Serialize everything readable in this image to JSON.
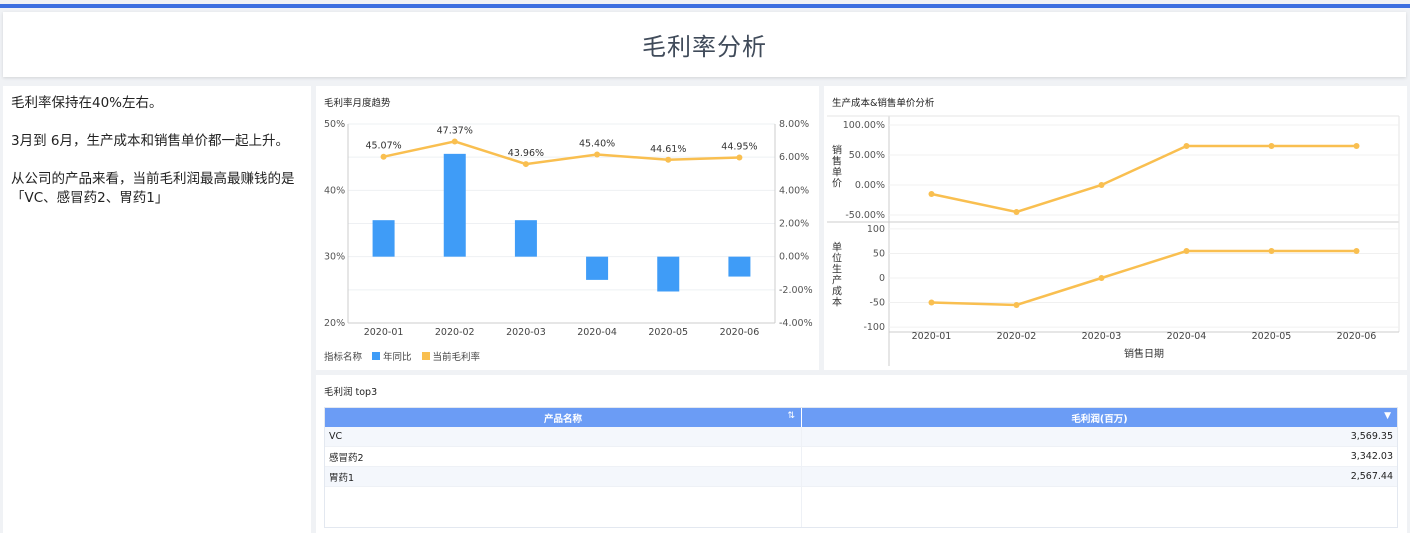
{
  "header": {
    "title": "毛利率分析"
  },
  "summary": {
    "p1": "毛利率保持在40%左右。",
    "p2": "3月到 6月，生产成本和销售单价都一起上升。",
    "p3": "从公司的产品来看，当前毛利润最高最赚钱的是「VC、感冒药2、胃药1」"
  },
  "chart_data": [
    {
      "type": "bar",
      "title": "毛利率月度趋势",
      "categories": [
        "2020-01",
        "2020-02",
        "2020-03",
        "2020-04",
        "2020-05",
        "2020-06"
      ],
      "series": [
        {
          "name": "年同比",
          "type": "bar",
          "axis": "right",
          "values": [
            2.2,
            6.2,
            2.2,
            -1.4,
            -2.1,
            -1.2
          ],
          "color": "#3f9cf7"
        },
        {
          "name": "当前毛利率",
          "type": "line",
          "axis": "left",
          "values": [
            45.07,
            47.37,
            43.96,
            45.4,
            44.61,
            44.95
          ],
          "labels": [
            "45.07%",
            "47.37%",
            "43.96%",
            "45.40%",
            "44.61%",
            "44.95%"
          ],
          "color": "#f9bf50"
        }
      ],
      "y_left": {
        "ticks": [
          "50%",
          "40%",
          "30%",
          "20%"
        ],
        "range": [
          20,
          50
        ]
      },
      "y_right": {
        "ticks": [
          "8.00%",
          "6.00%",
          "4.00%",
          "2.00%",
          "0.00%",
          "-2.00%",
          "-4.00%"
        ],
        "range": [
          -4,
          8
        ]
      },
      "legend": {
        "label": "指标名称",
        "items": [
          "年同比",
          "当前毛利率"
        ],
        "position": "bottom-left"
      }
    },
    {
      "type": "line",
      "title": "生产成本&销售单价分析",
      "categories": [
        "2020-01",
        "2020-02",
        "2020-03",
        "2020-04",
        "2020-05",
        "2020-06"
      ],
      "xlabel": "销售日期",
      "panels": [
        {
          "ylabel": "销售单价",
          "values": [
            -15,
            -45,
            0,
            65,
            65,
            65
          ],
          "ticks": [
            "100.00%",
            "50.00%",
            "0.00%",
            "-50.00%"
          ],
          "range": [
            -60,
            110
          ],
          "color": "#f9bf50"
        },
        {
          "ylabel": "单位生产成本",
          "values": [
            -50,
            -55,
            0,
            55,
            55,
            55
          ],
          "ticks": [
            "100",
            "50",
            "0",
            "-50",
            "-100"
          ],
          "range": [
            -110,
            110
          ],
          "color": "#f9bf50"
        }
      ]
    }
  ],
  "table": {
    "title": "毛利润 top3",
    "columns": [
      "产品名称",
      "毛利润(百万)"
    ],
    "sort_icon": "⇅",
    "filter_icon": "▼",
    "rows": [
      [
        "VC",
        "3,569.35"
      ],
      [
        "感冒药2",
        "3,342.03"
      ],
      [
        "胃药1",
        "2,567.44"
      ]
    ]
  }
}
